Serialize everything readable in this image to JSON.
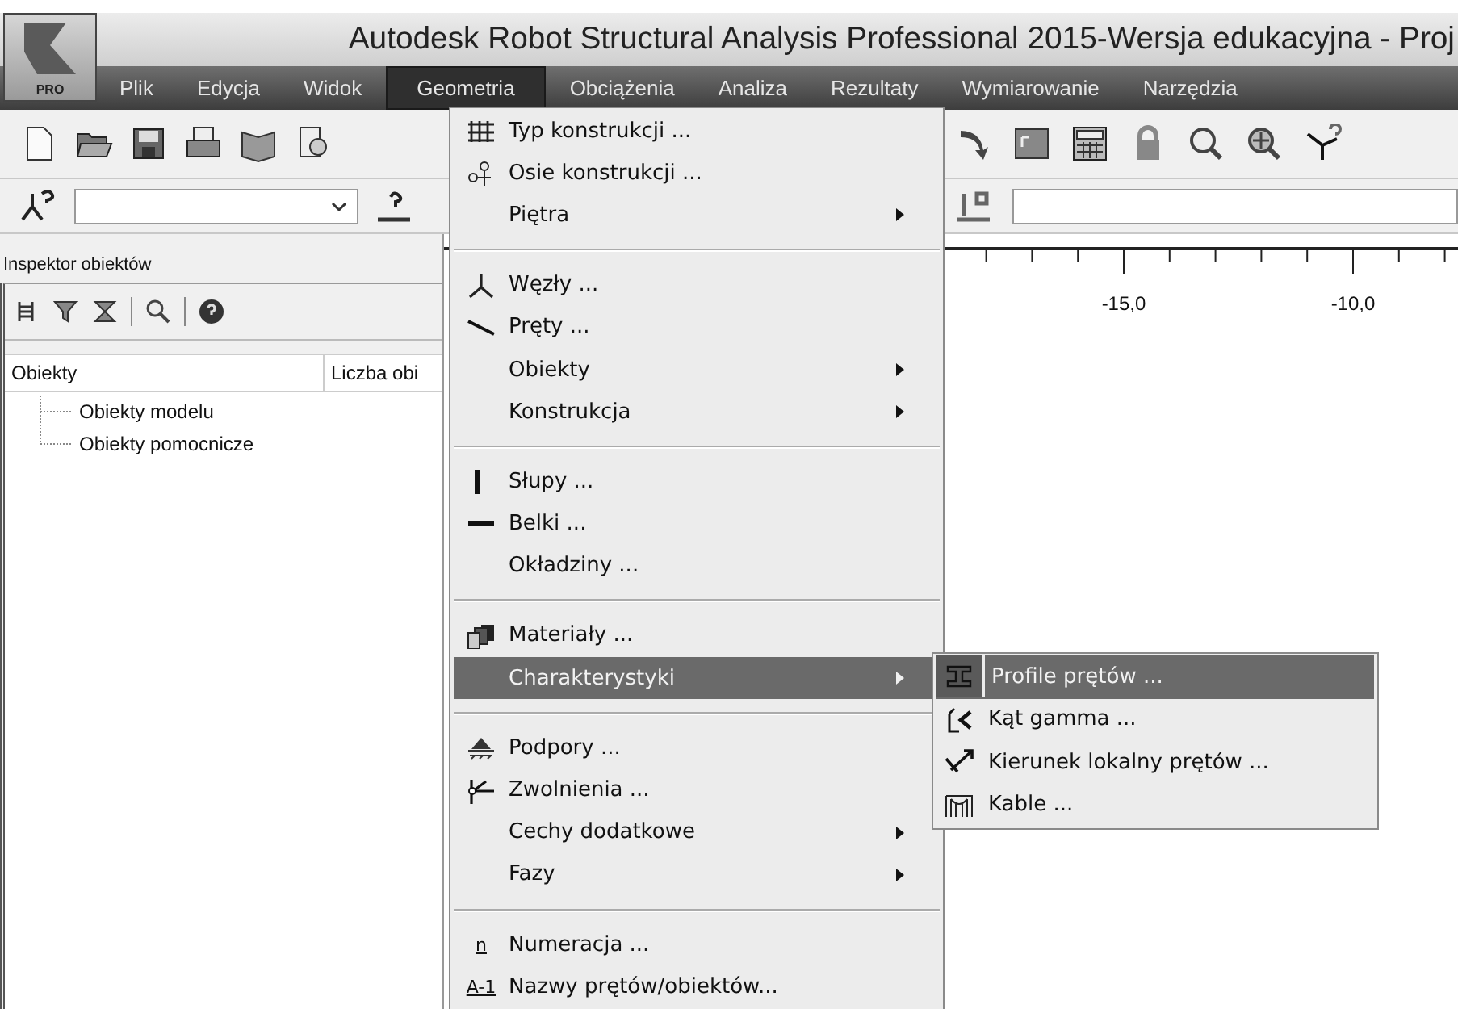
{
  "window": {
    "title": "Autodesk Robot Structural Analysis Professional 2015-Wersja edukacyjna - Proj",
    "badge": "PRO"
  },
  "menubar": [
    {
      "label": "Plik",
      "selected": false
    },
    {
      "label": "Edycja",
      "selected": false
    },
    {
      "label": "Widok",
      "selected": false
    },
    {
      "label": "Geometria",
      "selected": true
    },
    {
      "label": "Obciążenia",
      "selected": false
    },
    {
      "label": "Analiza",
      "selected": false
    },
    {
      "label": "Rezultaty",
      "selected": false
    },
    {
      "label": "Wymiarowanie",
      "selected": false
    },
    {
      "label": "Narzędzia",
      "selected": false
    }
  ],
  "inspector": {
    "title": "Inspektor obiektów",
    "columns": [
      "Obiekty",
      "Liczba obi"
    ],
    "tree": [
      {
        "label": "Obiekty modelu"
      },
      {
        "label": "Obiekty pomocnicze"
      }
    ]
  },
  "ruler": {
    "labels": [
      "-15,0",
      "-10,0"
    ]
  },
  "menu": {
    "items": [
      {
        "kind": "item",
        "label": "Typ konstrukcji ...",
        "submenu": false,
        "selected": false
      },
      {
        "kind": "item",
        "label": "Osie konstrukcji ...",
        "submenu": false,
        "selected": false
      },
      {
        "kind": "item",
        "label": "Piętra",
        "submenu": true,
        "selected": false
      },
      {
        "kind": "separator"
      },
      {
        "kind": "item",
        "label": "Węzły ...",
        "submenu": false,
        "selected": false
      },
      {
        "kind": "item",
        "label": "Pręty ...",
        "submenu": false,
        "selected": false
      },
      {
        "kind": "item",
        "label": "Obiekty",
        "submenu": true,
        "selected": false
      },
      {
        "kind": "item",
        "label": "Konstrukcja",
        "submenu": true,
        "selected": false
      },
      {
        "kind": "separator"
      },
      {
        "kind": "item",
        "label": "Słupy ...",
        "submenu": false,
        "selected": false
      },
      {
        "kind": "item",
        "label": "Belki ...",
        "submenu": false,
        "selected": false
      },
      {
        "kind": "item",
        "label": "Okładziny ...",
        "submenu": false,
        "selected": false
      },
      {
        "kind": "separator"
      },
      {
        "kind": "item",
        "label": "Materiały ...",
        "submenu": false,
        "selected": false
      },
      {
        "kind": "item",
        "label": "Charakterystyki",
        "submenu": true,
        "selected": true
      },
      {
        "kind": "separator"
      },
      {
        "kind": "item",
        "label": "Podpory ...",
        "submenu": false,
        "selected": false
      },
      {
        "kind": "item",
        "label": "Zwolnienia ...",
        "submenu": false,
        "selected": false
      },
      {
        "kind": "item",
        "label": "Cechy dodatkowe",
        "submenu": true,
        "selected": false
      },
      {
        "kind": "item",
        "label": "Fazy",
        "submenu": true,
        "selected": false
      },
      {
        "kind": "separator"
      },
      {
        "kind": "item",
        "label": "Numeracja ...",
        "submenu": false,
        "selected": false,
        "icon_text": "n"
      },
      {
        "kind": "item",
        "label": "Nazwy prętów/obiektów...",
        "submenu": false,
        "selected": false,
        "icon_text": "A-1"
      }
    ]
  },
  "submenu": {
    "items": [
      {
        "label": "Profile prętów ...",
        "selected": true
      },
      {
        "label": "Kąt gamma ...",
        "selected": false
      },
      {
        "label": "Kierunek lokalny prętów ...",
        "selected": false
      },
      {
        "label": "Kable ...",
        "selected": false
      }
    ]
  }
}
